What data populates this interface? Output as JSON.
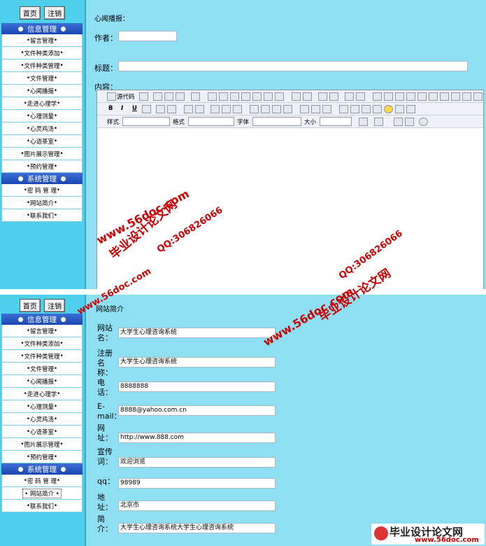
{
  "top_buttons": {
    "home": "首页",
    "logout": "注销"
  },
  "menu": {
    "info_header": "信息管理",
    "info_items": [
      "留言管理",
      "文件种类添加",
      "文件种类管理",
      "文件管理",
      "心闻播报",
      "走进心理学",
      "心理测量",
      "心灵鸡汤",
      "心语茶室",
      "图片展示管理",
      "预约管理"
    ],
    "system_header": "系统管理",
    "system_items": [
      "密 码 管 理",
      "网站简介",
      "联系我们"
    ]
  },
  "panel1": {
    "section_title": "心闻播报：",
    "author_label": "作者：",
    "title_label": "标题：",
    "content_label": "内容：",
    "toolbar": {
      "source_label": "源代码",
      "style_label": "样式",
      "format_label": "格式",
      "font_label": "字体",
      "size_label": "大小",
      "bold": "B",
      "italic": "I",
      "underline": "U"
    }
  },
  "panel2": {
    "section_title": "网站简介",
    "fields": [
      {
        "label": "网站名：",
        "value": "大学生心理咨询系统"
      },
      {
        "label": "注册名称：",
        "value": "大学生心理咨询系统"
      },
      {
        "label": "电话：",
        "value": "8888888"
      },
      {
        "label": "E-mail：",
        "value": "8888@yahoo.com.cn"
      },
      {
        "label": "网址：",
        "value": "http://www.888.com"
      },
      {
        "label": "宣传词：",
        "value": "欢迎浏览"
      },
      {
        "label": "qq：",
        "value": "98989"
      },
      {
        "label": "地址：",
        "value": "北京市"
      },
      {
        "label": "简介：",
        "value": "大学生心理咨询系统大学生心理咨询系统"
      }
    ]
  },
  "watermarks": {
    "site": "www.56doc.com",
    "qq": "QQ:306826066",
    "brand": "毕业设计论文网"
  },
  "logo": {
    "name": "毕业设计论文网",
    "url": "www.56doc.com"
  }
}
